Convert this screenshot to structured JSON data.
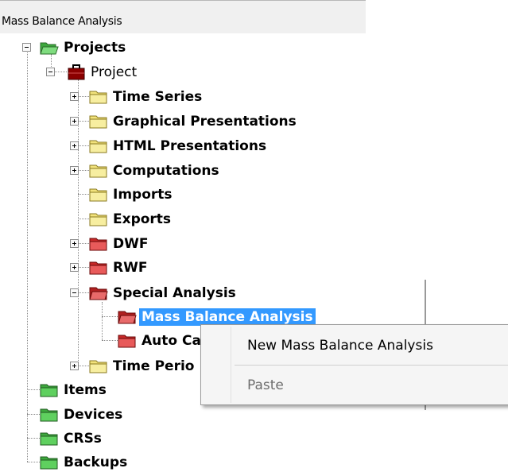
{
  "header": {
    "title": "Mass Balance Analysis"
  },
  "tree": {
    "projects": "Projects",
    "project": "Project",
    "time_series": "Time Series",
    "graphical_presentations": "Graphical Presentations",
    "html_presentations": "HTML Presentations",
    "computations": "Computations",
    "imports": "Imports",
    "exports": "Exports",
    "dwf": "DWF",
    "rwf": "RWF",
    "special_analysis": "Special Analysis",
    "mass_balance_analysis": "Mass Balance Analysis",
    "auto_calibration": "Auto Ca",
    "time_periods": "Time Perio",
    "items": "Items",
    "devices": "Devices",
    "crss": "CRSs",
    "backups": "Backups"
  },
  "context_menu": {
    "new_mass_balance_analysis": "New Mass Balance Analysis",
    "paste": "Paste"
  },
  "colors": {
    "selection": "#3399ff",
    "folder_yellow": "#f2e37c",
    "folder_red": "#d83b3b",
    "folder_green": "#4cc44c"
  }
}
